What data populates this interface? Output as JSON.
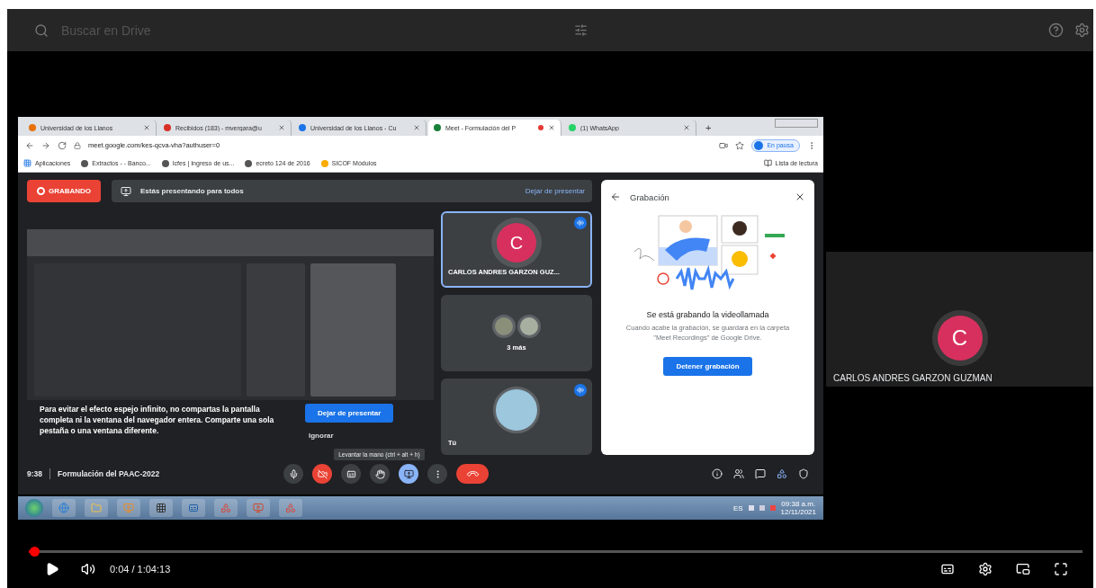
{
  "drive_bar": {
    "placeholder": "Buscar en Drive"
  },
  "browser": {
    "tabs": [
      {
        "label": "Universidad de los Llanos",
        "selected": false,
        "recording": false
      },
      {
        "label": "Recibidos (183) - mvergara@u",
        "selected": false,
        "recording": false
      },
      {
        "label": "Universidad de los Llanos - Cu",
        "selected": false,
        "recording": false
      },
      {
        "label": "Meet - Formulación del P",
        "selected": true,
        "recording": true
      },
      {
        "label": "(1) WhatsApp",
        "selected": false,
        "recording": false
      }
    ],
    "new_tab": "+",
    "address": "meet.google.com/kes-qcva-vha?authuser=0",
    "profile_status": "En pausa",
    "bookmarks": [
      "Aplicaciones",
      "Extractos - - Banco...",
      "Icfes | Ingreso de us...",
      "ecreto 124 de 2016",
      "SICOF Módulos"
    ],
    "reading_list": "Lista de lectura"
  },
  "meet": {
    "recording_label": "GRABANDO",
    "presenting_text": "Estás presentando para todos",
    "stop_presenting_link": "Dejar de presentar",
    "warning": "Para evitar el efecto espejo infinito, no compartas la pantalla completa ni la ventana del navegador entera. Comparte una sola pestaña o una ventana diferente.",
    "warning_button": "Dejar de presentar",
    "ignore_button": "Ignorar",
    "tiles": [
      {
        "kind": "avatar",
        "initial": "C",
        "name": "CARLOS ANDRES GARZON GUZ...",
        "highlighted": true,
        "speaking": true
      },
      {
        "kind": "group",
        "name": "3 más",
        "highlighted": false,
        "speaking": false
      },
      {
        "kind": "photo",
        "name": "Tú",
        "highlighted": false,
        "speaking": true
      }
    ],
    "panel": {
      "title": "Grabación",
      "heading": "Se está grabando la videollamada",
      "body": "Cuando acabe la grabación, se guardará en la carpeta \"Meet Recordings\" de Google Drive.",
      "button": "Detener grabación"
    },
    "time": "9:38",
    "meeting_title": "Formulación del PAAC-2022",
    "tooltip": "Levantar la mano (ctrl + alt + h)",
    "controls": [
      {
        "kind": "mic",
        "highlighted": false
      },
      {
        "kind": "camera",
        "highlighted": true
      },
      {
        "kind": "captions",
        "highlighted": false
      },
      {
        "kind": "hand",
        "highlighted": false
      },
      {
        "kind": "present",
        "highlighted": true
      },
      {
        "kind": "more",
        "highlighted": false
      },
      {
        "kind": "hangup",
        "highlighted": true
      }
    ]
  },
  "taskbar": {
    "language": "ES",
    "clock_time": "09:38 a.m.",
    "clock_date": "12/11/2021"
  },
  "side_tile": {
    "initial": "C",
    "name": "CARLOS ANDRES GARZON GUZMAN"
  },
  "player": {
    "progress": {
      "level": 0.001
    },
    "time": "0:04 / 1:04:13"
  }
}
